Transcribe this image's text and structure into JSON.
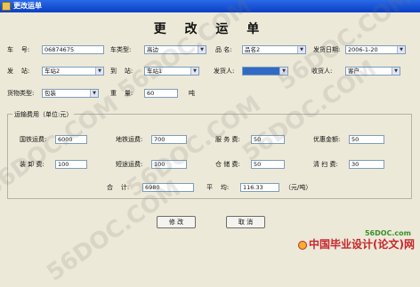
{
  "window": {
    "title": "更改运单"
  },
  "heading": "更 改 运 单",
  "row1": {
    "car_no_label": "车    号:",
    "car_no_value": "06874675",
    "car_type_label": "车类型:",
    "car_type_value": "高边",
    "product_label": "品 名:",
    "product_value": "品名2",
    "ship_date_label": "发货日期:",
    "ship_date_value": "2006-1-20"
  },
  "row2": {
    "from_station_label": "发    站:",
    "from_station_value": "车站2",
    "to_station_label": "到    站:",
    "to_station_value": "车站1",
    "shipper_label": "发货人:",
    "shipper_value": "",
    "receiver_label": "收货人:",
    "receiver_value": "客户"
  },
  "row3": {
    "cargo_type_label": "货物类型:",
    "cargo_type_value": "包装",
    "weight_label": "重    量:",
    "weight_value": "60",
    "weight_unit": "吨"
  },
  "fees": {
    "group_title": "运输费用（单位:元）",
    "national_rail_label": "国铁运费:",
    "national_rail_value": "6000",
    "local_rail_label": "地铁运费:",
    "local_rail_value": "700",
    "service_label": "服 务 费:",
    "service_value": "50",
    "discount_label": "优惠金额:",
    "discount_value": "50",
    "loading_label": "装 卸 费:",
    "loading_value": "100",
    "short_haul_label": "短途运费:",
    "short_haul_value": "100",
    "storage_label": "仓 储 费:",
    "storage_value": "50",
    "cleaning_label": "清 扫 费:",
    "cleaning_value": "30",
    "total_label": "合    计:",
    "total_value": "6980",
    "average_label": "平    均:",
    "average_value": "116.33",
    "average_unit": "（元/吨）"
  },
  "buttons": {
    "modify": "修 改",
    "cancel": "取 消"
  },
  "watermarks": [
    "56DOC.COM",
    "56DOC.COM",
    "56DOC.COM",
    "56DOC.COM",
    "56DOC.COM",
    "56DOC.COM"
  ],
  "footer": {
    "site": "56DOC.com",
    "brand": "中国毕业设计(论文)网"
  }
}
